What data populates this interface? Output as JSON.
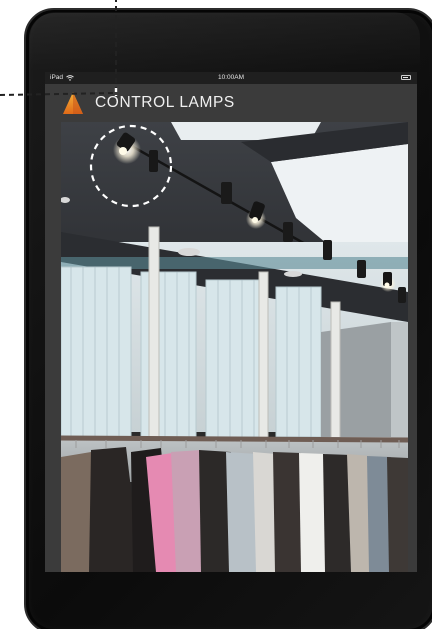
{
  "statusbar": {
    "device": "iPad",
    "wifi_icon": "wifi-icon",
    "time": "10:00AM",
    "battery_icon": "battery-icon"
  },
  "app": {
    "title": "CONTROL LAMPS",
    "logo_icon": "lamp-logo-icon",
    "accent_color": "#f0a020"
  },
  "camera": {
    "highlighted_lamp": "lamp-1",
    "lamps": [
      "lamp-1",
      "lamp-2",
      "lamp-3",
      "lamp-4",
      "lamp-5",
      "lamp-6",
      "lamp-7",
      "lamp-8"
    ]
  },
  "colors": {
    "device_frame": "#111111",
    "screen_bg": "#3b3b3b",
    "statusbar_bg": "#1f1f1f",
    "callout_line": "#222222"
  }
}
